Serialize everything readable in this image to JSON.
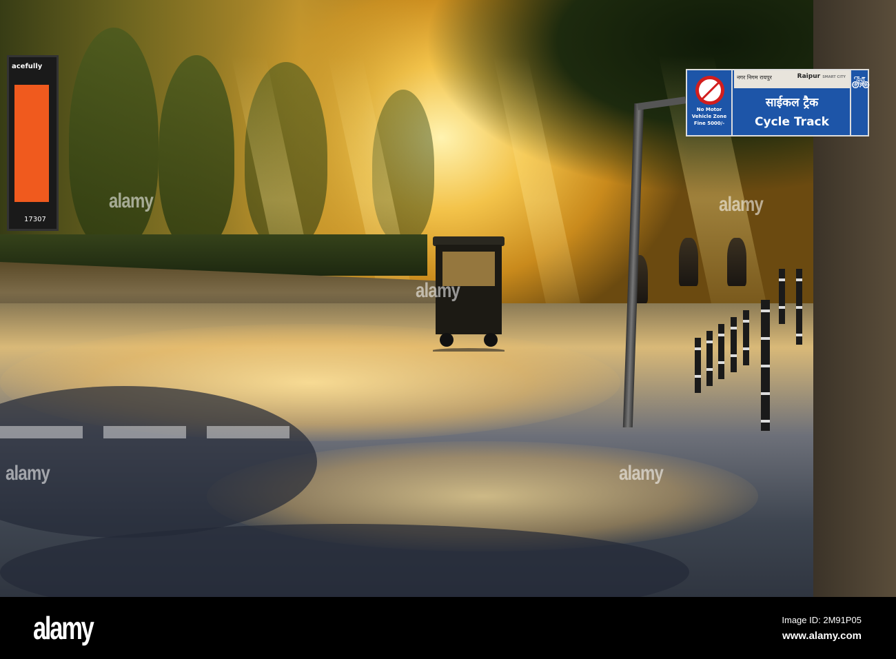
{
  "sign": {
    "header_hindi": "नगर निगम रायपुर",
    "brand": "Raipur",
    "brand_sub": "SMART CITY",
    "title_hindi": "साईकल ट्रैक",
    "title_english": "Cycle Track",
    "notice_lines": [
      "No Motor",
      "Vehicle Zone",
      "Fine 5000/-"
    ]
  },
  "billboard": {
    "text": "acefully",
    "number": "17307"
  },
  "watermark": "alamy",
  "footer": {
    "logo": "alamy",
    "image_id": "Image ID: 2M91P05",
    "url": "www.alamy.com"
  }
}
